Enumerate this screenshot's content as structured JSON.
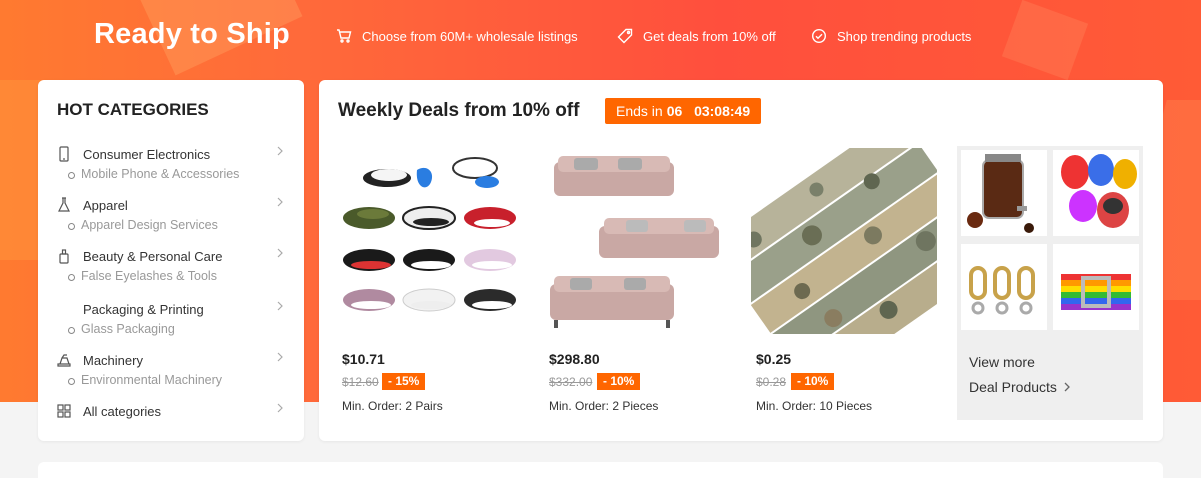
{
  "banner": {
    "title": "Ready to Ship",
    "benefits": [
      {
        "icon": "cart-icon",
        "label": "Choose from 60M+ wholesale listings"
      },
      {
        "icon": "tag-icon",
        "label": "Get deals from 10% off"
      },
      {
        "icon": "check-circle-icon",
        "label": "Shop trending products"
      }
    ]
  },
  "categories": {
    "title": "HOT CATEGORIES",
    "items": [
      {
        "icon": "phone-icon",
        "label": "Consumer Electronics",
        "sub": "Mobile Phone & Accessories"
      },
      {
        "icon": "flask-icon",
        "label": "Apparel",
        "sub": "Apparel Design Services"
      },
      {
        "icon": "perfume-icon",
        "label": "Beauty & Personal Care",
        "sub": "False Eyelashes & Tools"
      },
      {
        "icon": "",
        "label": "Packaging & Printing",
        "sub": "Glass Packaging"
      },
      {
        "icon": "machinery-icon",
        "label": "Machinery",
        "sub": "Environmental Machinery"
      },
      {
        "icon": "grid-icon",
        "label": "All categories",
        "sub": ""
      }
    ]
  },
  "deals": {
    "title": "Weekly Deals from 10% off",
    "countdown": {
      "prefix": "Ends in",
      "days": "06",
      "time": "03:08:49"
    },
    "products": [
      {
        "image": "sneakers-image",
        "price": "$10.71",
        "original": "$12.60",
        "discount": "- 15%",
        "moq": "Min. Order: 2 Pairs"
      },
      {
        "image": "sofa-image",
        "price": "$298.80",
        "original": "$332.00",
        "discount": "- 10%",
        "moq": "Min. Order: 2 Pieces"
      },
      {
        "image": "camouflage-fabric-image",
        "price": "$0.25",
        "original": "$0.28",
        "discount": "- 10%",
        "moq": "Min. Order: 10 Pieces"
      }
    ],
    "more": {
      "line1": "View more",
      "line2": "Deal Products"
    }
  },
  "colors": {
    "accent": "#ff6600",
    "banner": "#ff5a3c"
  }
}
